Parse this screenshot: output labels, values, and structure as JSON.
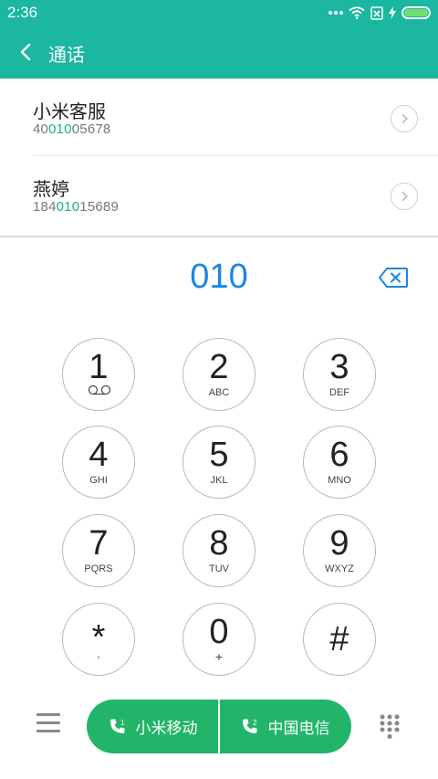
{
  "status_bar": {
    "time": "2:36",
    "icons": [
      "more-dots-icon",
      "wifi-icon",
      "no-sim-icon",
      "charging-icon",
      "battery-icon"
    ],
    "battery_level": 1.0
  },
  "app_bar": {
    "title": "通话",
    "back_icon": "chevron-left-icon"
  },
  "search_results": [
    {
      "name": "小米客服",
      "number_prefix": "40",
      "number_match": "010",
      "number_suffix": "05678"
    },
    {
      "name": "燕婷",
      "number_prefix": "184",
      "number_match": "010",
      "number_suffix": "15689"
    }
  ],
  "dial_input": {
    "value": "010",
    "backspace_icon": "backspace-icon"
  },
  "keypad": [
    {
      "digit": "1",
      "letters": "",
      "icon": "voicemail-icon"
    },
    {
      "digit": "2",
      "letters": "ABC"
    },
    {
      "digit": "3",
      "letters": "DEF"
    },
    {
      "digit": "4",
      "letters": "GHI"
    },
    {
      "digit": "5",
      "letters": "JKL"
    },
    {
      "digit": "6",
      "letters": "MNO"
    },
    {
      "digit": "7",
      "letters": "PQRS"
    },
    {
      "digit": "8",
      "letters": "TUV"
    },
    {
      "digit": "9",
      "letters": "WXYZ"
    },
    {
      "digit": "*",
      "letters": ","
    },
    {
      "digit": "0",
      "letters": "+"
    },
    {
      "digit": "#",
      "letters": ""
    }
  ],
  "bottom_bar": {
    "menu_icon": "menu-icon",
    "sim1": {
      "label": "小米移动",
      "icon": "phone-sim1-icon"
    },
    "sim2": {
      "label": "中国电信",
      "icon": "phone-sim2-icon"
    },
    "keypad_toggle_icon": "dialpad-icon"
  },
  "colors": {
    "accent": "#1bb7a0",
    "call_green": "#22b56a",
    "typed_blue": "#1b86e5",
    "match_green": "#1bb37a"
  }
}
